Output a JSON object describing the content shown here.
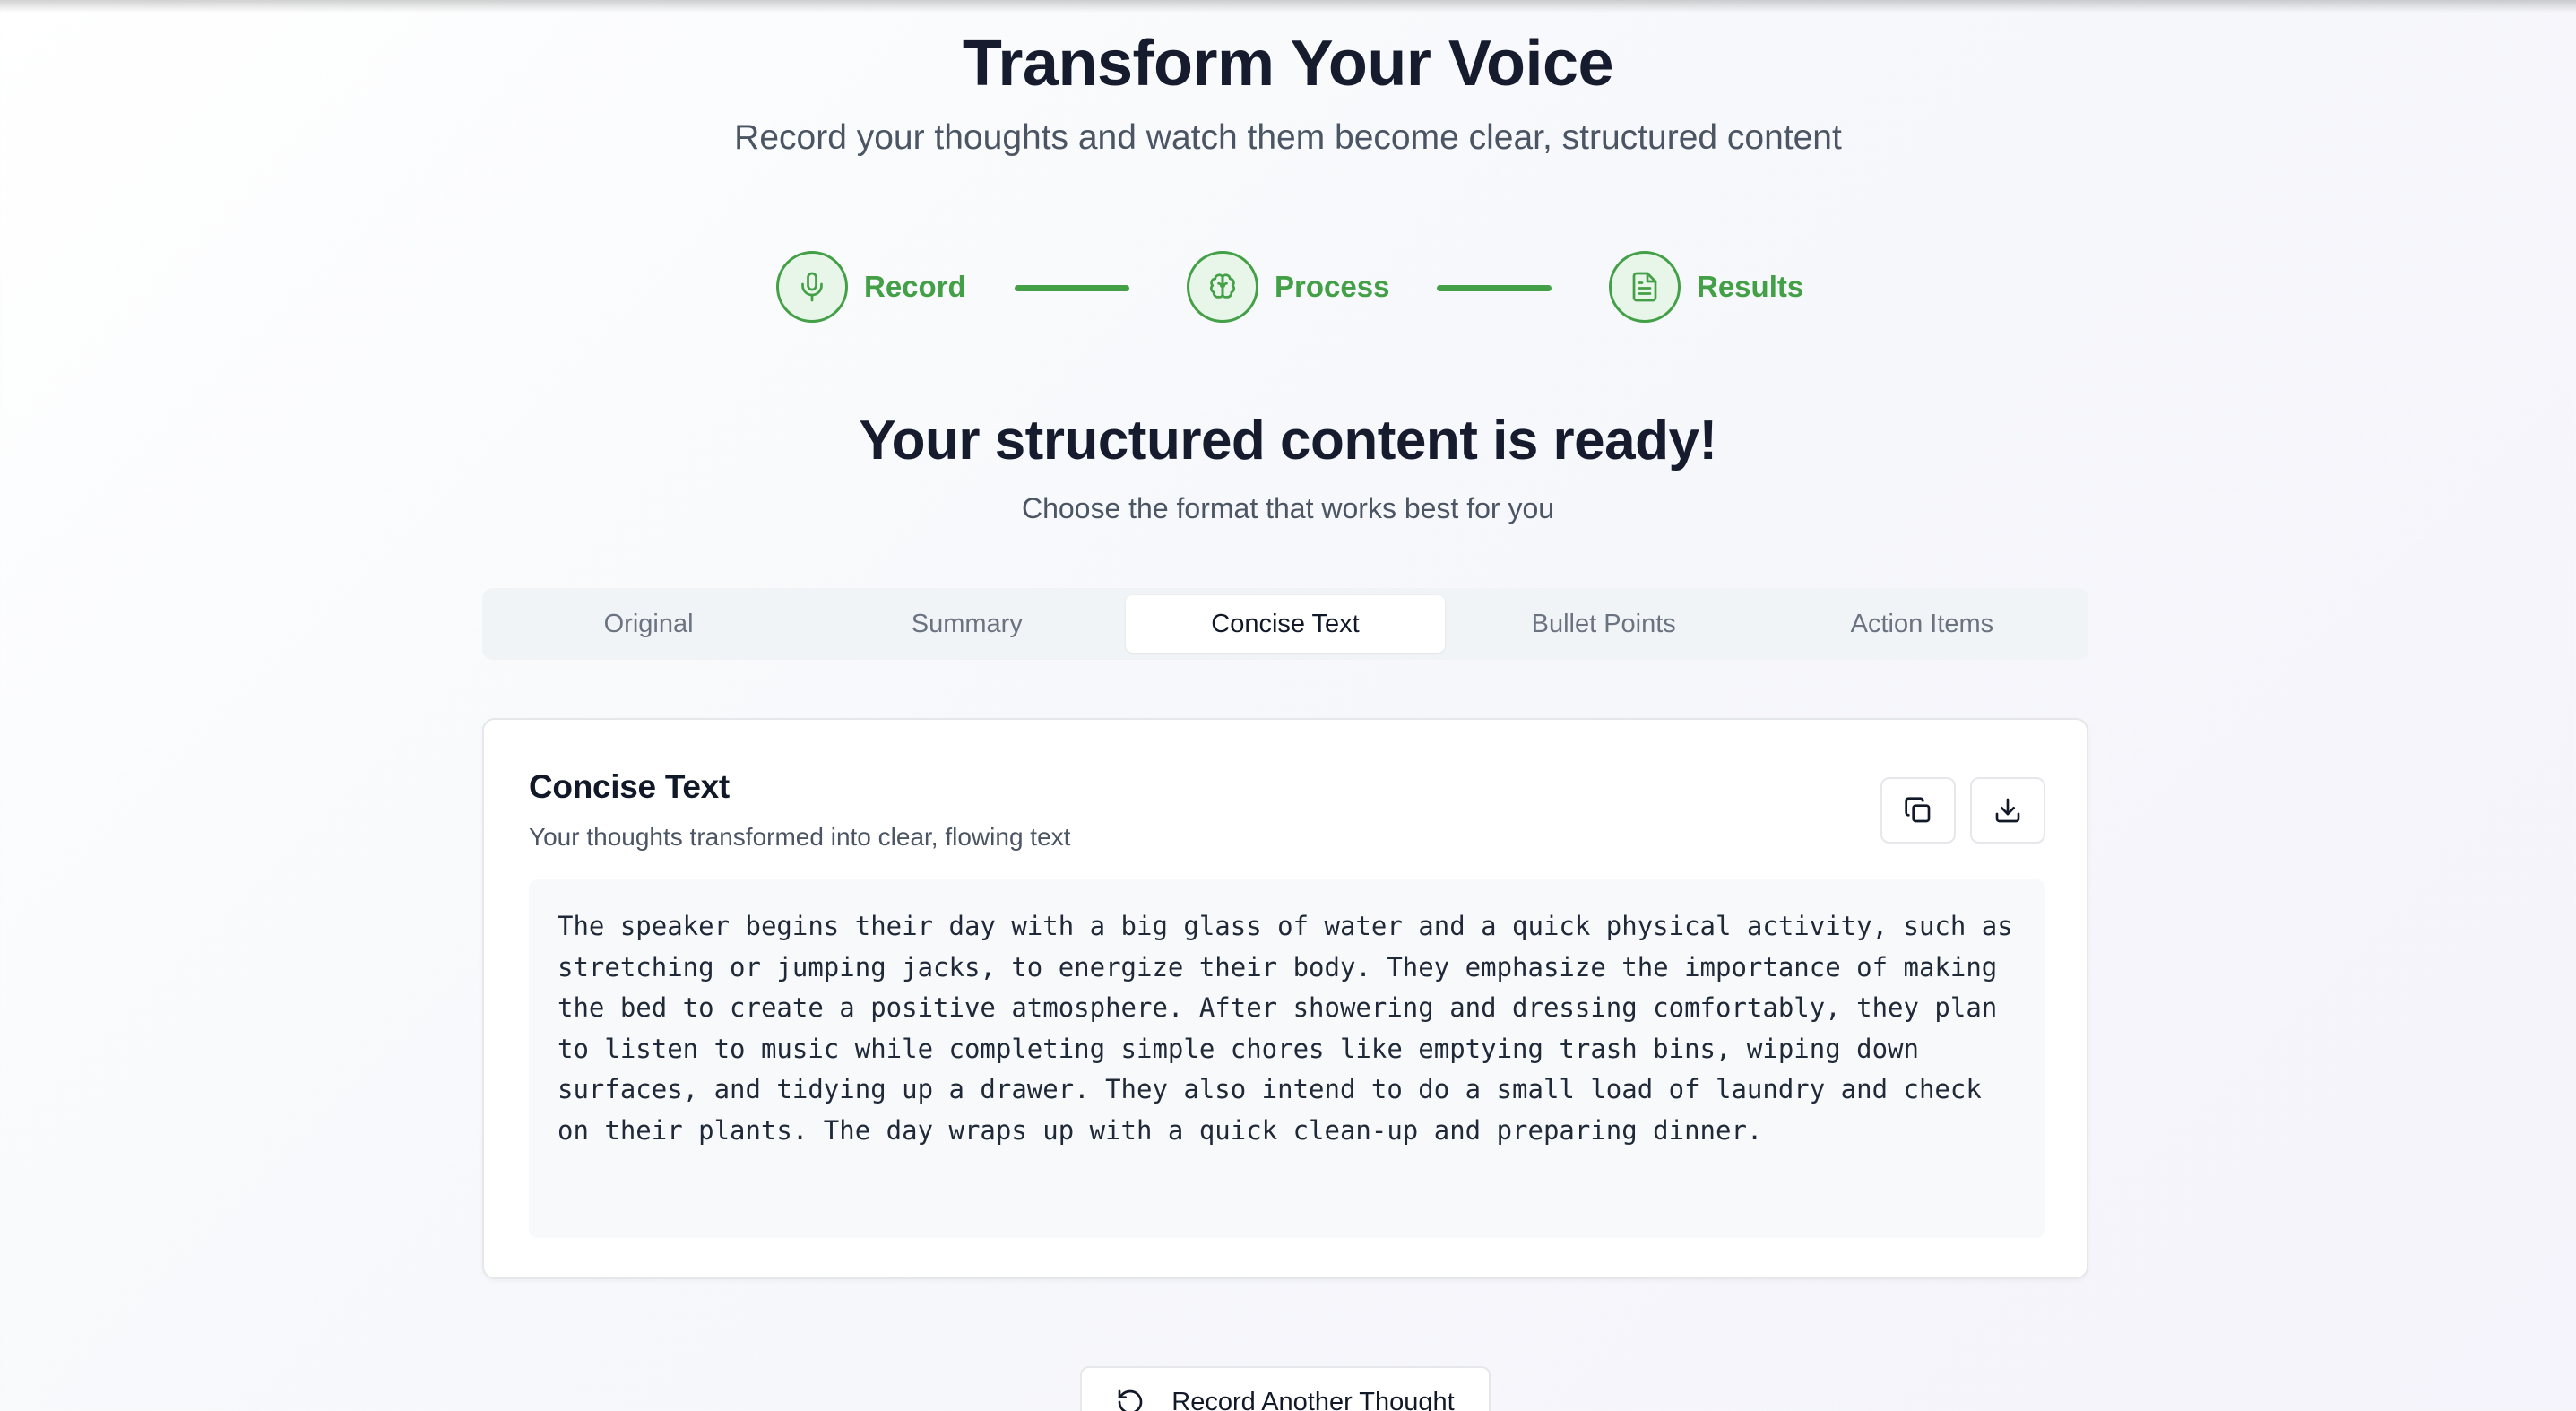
{
  "header": {
    "title": "Transform Your Voice",
    "subtitle": "Record your thoughts and watch them become clear, structured content"
  },
  "steps": [
    {
      "label": "Record",
      "icon": "microphone-icon"
    },
    {
      "label": "Process",
      "icon": "brain-icon"
    },
    {
      "label": "Results",
      "icon": "document-icon"
    }
  ],
  "colors": {
    "accent": "#43a047",
    "accent_light": "#e8f5e9",
    "heading": "#161b2e",
    "muted": "#4b5563"
  },
  "result": {
    "title": "Your structured content is ready!",
    "subtitle": "Choose the format that works best for you"
  },
  "tabs": [
    {
      "label": "Original",
      "active": false
    },
    {
      "label": "Summary",
      "active": false
    },
    {
      "label": "Concise Text",
      "active": true
    },
    {
      "label": "Bullet Points",
      "active": false
    },
    {
      "label": "Action Items",
      "active": false
    }
  ],
  "card": {
    "title": "Concise Text",
    "description": "Your thoughts transformed into clear, flowing text",
    "copy_icon": "copy-icon",
    "download_icon": "download-icon",
    "content": "The speaker begins their day with a big glass of water and a quick physical activity, such as stretching or jumping jacks, to energize their body. They emphasize the importance of making the bed to create a positive atmosphere. After showering and dressing comfortably, they plan to listen to music while completing simple chores like emptying trash bins, wiping down surfaces, and tidying up a drawer. They also intend to do a small load of laundry and check on their plants. The day wraps up with a quick clean-up and preparing dinner."
  },
  "footer": {
    "record_again_label": "Record Another Thought",
    "record_again_icon": "rotate-ccw-icon"
  }
}
